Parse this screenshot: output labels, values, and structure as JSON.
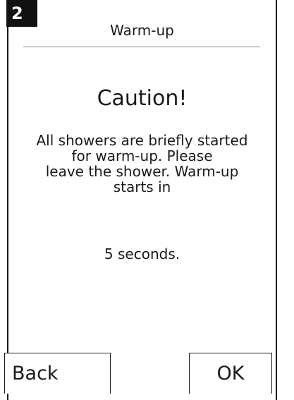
{
  "header": {
    "step_number": "2",
    "title": "Warm-up"
  },
  "main": {
    "heading": "Caution!",
    "message": "All showers are briefly started\nfor warm-up. Please\nleave the shower. Warm-up\nstarts in",
    "countdown": "5 seconds."
  },
  "buttons": {
    "back_label": "Back",
    "ok_label": "OK"
  }
}
